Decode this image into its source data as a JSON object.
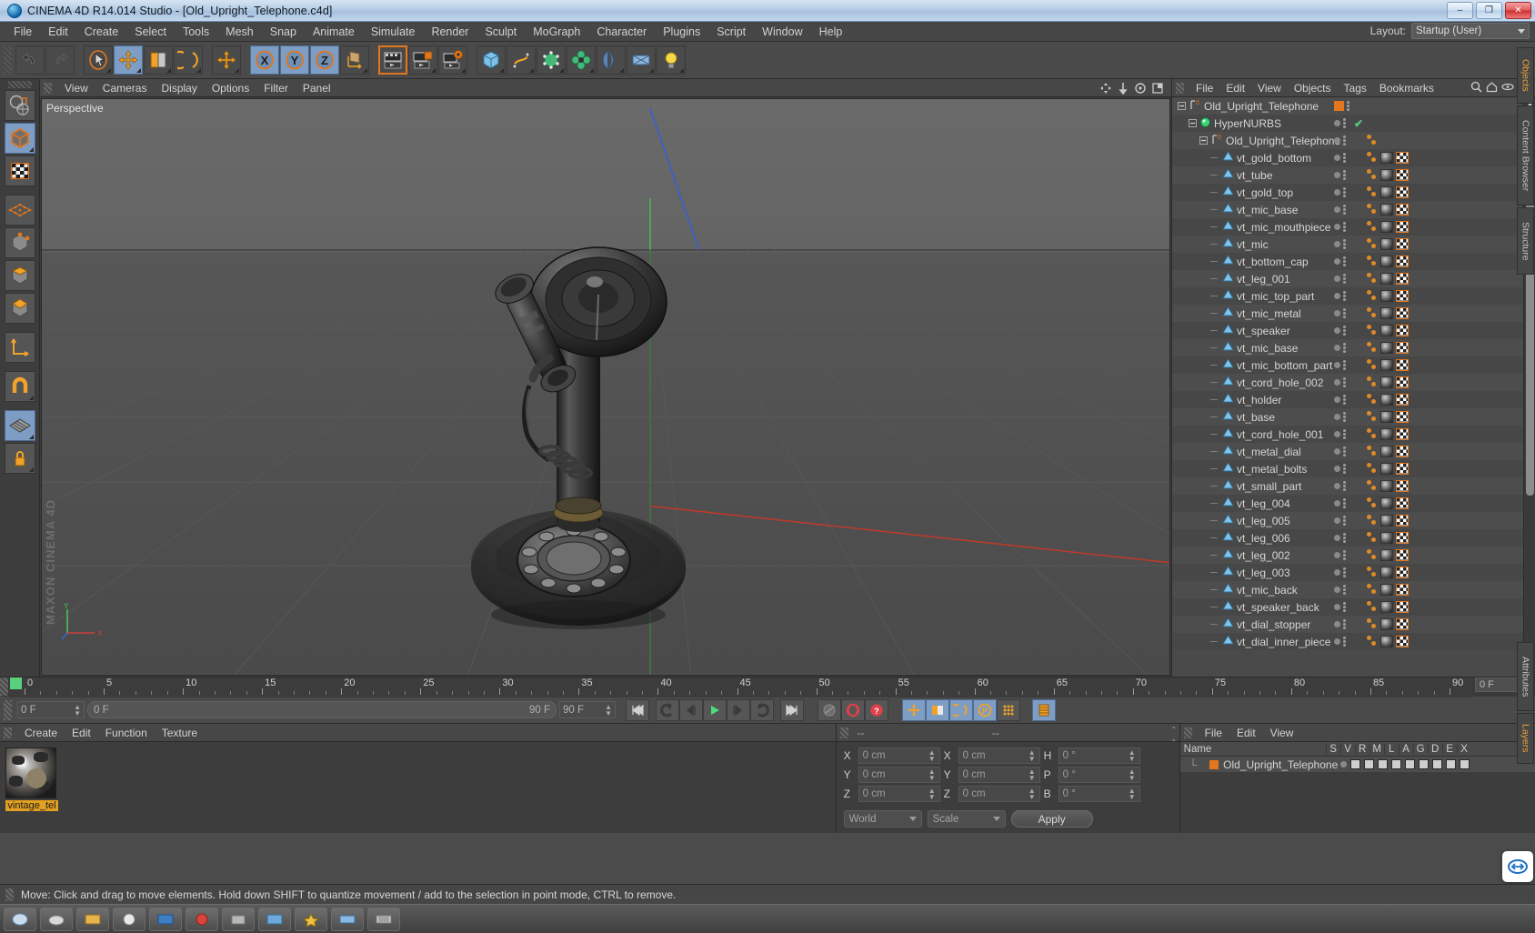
{
  "window": {
    "title": "CINEMA 4D R14.014 Studio - [Old_Upright_Telephone.c4d]",
    "minimize": "–",
    "maximize": "❐",
    "close": "✕"
  },
  "menubar": {
    "items": [
      "File",
      "Edit",
      "Create",
      "Select",
      "Tools",
      "Mesh",
      "Snap",
      "Animate",
      "Simulate",
      "Render",
      "Sculpt",
      "MoGraph",
      "Character",
      "Plugins",
      "Script",
      "Window",
      "Help"
    ],
    "layout_label": "Layout:",
    "layout_value": "Startup (User)"
  },
  "toolbar": {
    "groups": [
      {
        "buttons": [
          {
            "name": "undo-button",
            "icon": "undo-icon",
            "state": "normal"
          },
          {
            "name": "redo-button",
            "icon": "redo-icon",
            "state": "disabled"
          }
        ]
      },
      {
        "buttons": [
          {
            "name": "live-selection-button",
            "icon": "cursor-select-icon",
            "state": "normal"
          },
          {
            "name": "move-tool-button",
            "icon": "move-icon",
            "state": "selected"
          },
          {
            "name": "scale-tool-button",
            "icon": "scale-icon",
            "state": "normal"
          },
          {
            "name": "rotate-tool-button",
            "icon": "rotate-icon",
            "state": "normal"
          }
        ]
      },
      {
        "buttons": [
          {
            "name": "move-duplicate-button",
            "icon": "move-plus-icon",
            "state": "normal"
          }
        ]
      },
      {
        "buttons": [
          {
            "name": "x-axis-lock-button",
            "icon": "axis-x-icon",
            "state": "selected"
          },
          {
            "name": "y-axis-lock-button",
            "icon": "axis-y-icon",
            "state": "selected"
          },
          {
            "name": "z-axis-lock-button",
            "icon": "axis-z-icon",
            "state": "selected"
          },
          {
            "name": "world-object-coordinate-button",
            "icon": "world-axis-icon",
            "state": "normal"
          }
        ]
      },
      {
        "buttons": [
          {
            "name": "render-view-button",
            "icon": "clapper-icon",
            "state": "outlined"
          },
          {
            "name": "render-region-button",
            "icon": "clapper-region-icon",
            "state": "normal"
          },
          {
            "name": "render-settings-button",
            "icon": "clapper-gear-icon",
            "state": "normal"
          }
        ]
      },
      {
        "buttons": [
          {
            "name": "add-cube-button",
            "icon": "cube-icon",
            "state": "normal"
          },
          {
            "name": "add-spline-button",
            "icon": "spline-icon",
            "state": "normal"
          },
          {
            "name": "add-generator-button",
            "icon": "nurbs-icon",
            "state": "normal"
          },
          {
            "name": "add-deformer-button",
            "icon": "deformer-icon",
            "state": "normal"
          },
          {
            "name": "add-environment-button",
            "icon": "environment-icon",
            "state": "normal"
          },
          {
            "name": "add-camera-button",
            "icon": "camera-icon",
            "state": "normal"
          },
          {
            "name": "add-light-button",
            "icon": "light-bulb-icon",
            "state": "normal"
          }
        ]
      }
    ]
  },
  "leftbar": {
    "buttons": [
      {
        "name": "model-mode-button",
        "icon": "cube-model-icon",
        "state": "selected"
      },
      {
        "name": "texture-mode-button",
        "icon": "checker-texture-icon",
        "state": "normal"
      },
      {
        "name": "points-mode-button",
        "icon": "points-grid-icon",
        "state": "normal"
      },
      {
        "name": "edges-mode-button",
        "icon": "edge-cube-icon",
        "state": "normal"
      },
      {
        "name": "polygons-mode-button",
        "icon": "polygon-cube-icon",
        "state": "normal"
      },
      {
        "name": "faces-mode-button",
        "icon": "face-cube-icon",
        "state": "normal"
      },
      {
        "name": "axis-mode-button",
        "icon": "axis-arrow-icon",
        "state": "normal"
      },
      {
        "name": "enable-snap-button",
        "icon": "magnet-icon",
        "state": "normal"
      },
      {
        "name": "workplane-button",
        "icon": "workplane-grid-icon",
        "state": "selected"
      },
      {
        "name": "lock-workplane-button",
        "icon": "lock-icon",
        "state": "normal"
      }
    ]
  },
  "viewport": {
    "menu": [
      "View",
      "Cameras",
      "Display",
      "Options",
      "Filter",
      "Panel"
    ],
    "label": "Perspective",
    "axis_labels": {
      "x": "X",
      "y": "Y",
      "z": "Z"
    },
    "hud_icons": [
      "move-view-icon",
      "pan-view-icon",
      "rotate-view-icon",
      "maximize-view-icon"
    ]
  },
  "object_manager": {
    "menu": [
      "File",
      "Edit",
      "View",
      "Objects",
      "Tags",
      "Bookmarks"
    ],
    "header_icons": [
      "search-icon",
      "home-icon",
      "eye-icon",
      "expand-icon"
    ],
    "tree": [
      {
        "label": "Old_Upright_Telephone",
        "depth": 0,
        "icon": "null-object-icon",
        "type": "null",
        "swatch": "#e2761c",
        "has_tags": false
      },
      {
        "label": "HyperNURBS",
        "depth": 1,
        "icon": "hypernurbs-icon",
        "type": "generator",
        "check": true,
        "has_tags": false
      },
      {
        "label": "Old_Upright_Telephone",
        "depth": 2,
        "icon": "null-object-icon",
        "type": "null",
        "has_tags": false,
        "has_dots": true
      },
      {
        "label": "vt_gold_bottom",
        "depth": 3,
        "icon": "polygon-object-icon",
        "type": "mesh",
        "has_tags": true
      },
      {
        "label": "vt_tube",
        "depth": 3,
        "icon": "polygon-object-icon",
        "type": "mesh",
        "has_tags": true
      },
      {
        "label": "vt_gold_top",
        "depth": 3,
        "icon": "polygon-object-icon",
        "type": "mesh",
        "has_tags": true
      },
      {
        "label": "vt_mic_base",
        "depth": 3,
        "icon": "polygon-object-icon",
        "type": "mesh",
        "has_tags": true
      },
      {
        "label": "vt_mic_mouthpiece",
        "depth": 3,
        "icon": "polygon-object-icon",
        "type": "mesh",
        "has_tags": true
      },
      {
        "label": "vt_mic",
        "depth": 3,
        "icon": "polygon-object-icon",
        "type": "mesh",
        "has_tags": true
      },
      {
        "label": "vt_bottom_cap",
        "depth": 3,
        "icon": "polygon-object-icon",
        "type": "mesh",
        "has_tags": true
      },
      {
        "label": "vt_leg_001",
        "depth": 3,
        "icon": "polygon-object-icon",
        "type": "mesh",
        "has_tags": true
      },
      {
        "label": "vt_mic_top_part",
        "depth": 3,
        "icon": "polygon-object-icon",
        "type": "mesh",
        "has_tags": true
      },
      {
        "label": "vt_mic_metal",
        "depth": 3,
        "icon": "polygon-object-icon",
        "type": "mesh",
        "has_tags": true
      },
      {
        "label": "vt_speaker",
        "depth": 3,
        "icon": "polygon-object-icon",
        "type": "mesh",
        "has_tags": true
      },
      {
        "label": "vt_mic_base",
        "depth": 3,
        "icon": "polygon-object-icon",
        "type": "mesh",
        "has_tags": true
      },
      {
        "label": "vt_mic_bottom_part",
        "depth": 3,
        "icon": "polygon-object-icon",
        "type": "mesh",
        "has_tags": true
      },
      {
        "label": "vt_cord_hole_002",
        "depth": 3,
        "icon": "polygon-object-icon",
        "type": "mesh",
        "has_tags": true
      },
      {
        "label": "vt_holder",
        "depth": 3,
        "icon": "polygon-object-icon",
        "type": "mesh",
        "has_tags": true
      },
      {
        "label": "vt_base",
        "depth": 3,
        "icon": "polygon-object-icon",
        "type": "mesh",
        "has_tags": true
      },
      {
        "label": "vt_cord_hole_001",
        "depth": 3,
        "icon": "polygon-object-icon",
        "type": "mesh",
        "has_tags": true
      },
      {
        "label": "vt_metal_dial",
        "depth": 3,
        "icon": "polygon-object-icon",
        "type": "mesh",
        "has_tags": true
      },
      {
        "label": "vt_metal_bolts",
        "depth": 3,
        "icon": "polygon-object-icon",
        "type": "mesh",
        "has_tags": true
      },
      {
        "label": "vt_small_part",
        "depth": 3,
        "icon": "polygon-object-icon",
        "type": "mesh",
        "has_tags": true
      },
      {
        "label": "vt_leg_004",
        "depth": 3,
        "icon": "polygon-object-icon",
        "type": "mesh",
        "has_tags": true
      },
      {
        "label": "vt_leg_005",
        "depth": 3,
        "icon": "polygon-object-icon",
        "type": "mesh",
        "has_tags": true
      },
      {
        "label": "vt_leg_006",
        "depth": 3,
        "icon": "polygon-object-icon",
        "type": "mesh",
        "has_tags": true
      },
      {
        "label": "vt_leg_002",
        "depth": 3,
        "icon": "polygon-object-icon",
        "type": "mesh",
        "has_tags": true
      },
      {
        "label": "vt_leg_003",
        "depth": 3,
        "icon": "polygon-object-icon",
        "type": "mesh",
        "has_tags": true
      },
      {
        "label": "vt_mic_back",
        "depth": 3,
        "icon": "polygon-object-icon",
        "type": "mesh",
        "has_tags": true
      },
      {
        "label": "vt_speaker_back",
        "depth": 3,
        "icon": "polygon-object-icon",
        "type": "mesh",
        "has_tags": true
      },
      {
        "label": "vt_dial_stopper",
        "depth": 3,
        "icon": "polygon-object-icon",
        "type": "mesh",
        "has_tags": true
      },
      {
        "label": "vt_dial_inner_piece",
        "depth": 3,
        "icon": "polygon-object-icon",
        "type": "mesh",
        "has_tags": true
      }
    ]
  },
  "timeline": {
    "ticks": [
      "0",
      "5",
      "10",
      "15",
      "20",
      "25",
      "30",
      "35",
      "40",
      "45",
      "50",
      "55",
      "60",
      "65",
      "70",
      "75",
      "80",
      "85",
      "90"
    ],
    "current_frame_display": "0 F",
    "playhead_frame": 0
  },
  "transport": {
    "current_frame": "0 F",
    "range_start": "0 F",
    "range_end": "90 F",
    "end_frame_field": "90 F",
    "buttons": [
      {
        "name": "go-to-start-button",
        "icon": "skip-start-icon"
      },
      {
        "name": "play-backwards-loop-button",
        "icon": "loop-back-icon"
      },
      {
        "name": "previous-frame-button",
        "icon": "step-back-icon"
      },
      {
        "name": "play-button",
        "icon": "play-icon"
      },
      {
        "name": "next-frame-button",
        "icon": "step-forward-icon"
      },
      {
        "name": "play-forward-loop-button",
        "icon": "loop-forward-icon"
      },
      {
        "name": "go-to-end-button",
        "icon": "skip-end-icon"
      },
      {
        "name": "record-active-objects-button",
        "icon": "record-icon"
      },
      {
        "name": "autokeying-button",
        "icon": "autokey-icon"
      },
      {
        "name": "keyframe-selection-button",
        "icon": "key-selection-icon"
      },
      {
        "name": "position-key-button",
        "icon": "position-key-icon"
      },
      {
        "name": "scale-key-button",
        "icon": "scale-key-icon"
      },
      {
        "name": "rotation-key-button",
        "icon": "rotation-key-icon"
      },
      {
        "name": "param-key-button",
        "icon": "param-key-icon"
      },
      {
        "name": "point-level-animation-button",
        "icon": "pla-icon"
      },
      {
        "name": "timeline-toggle-button",
        "icon": "timeline-icon"
      }
    ]
  },
  "material_manager": {
    "menu": [
      "Create",
      "Edit",
      "Function",
      "Texture"
    ],
    "materials": [
      {
        "name": "vintage_tel",
        "selected": true
      }
    ]
  },
  "coordinates": {
    "col_headers": [
      "--",
      "--",
      "--"
    ],
    "rows": [
      {
        "label1": "X",
        "value1": "0 cm",
        "label2": "X",
        "value2": "0 cm",
        "label3": "H",
        "value3": "0 °"
      },
      {
        "label1": "Y",
        "value1": "0 cm",
        "label2": "Y",
        "value2": "0 cm",
        "label3": "P",
        "value3": "0 °"
      },
      {
        "label1": "Z",
        "value1": "0 cm",
        "label2": "Z",
        "value2": "0 cm",
        "label3": "B",
        "value3": "0 °"
      }
    ],
    "space_select": "World",
    "mode_select": "Scale",
    "apply_label": "Apply"
  },
  "layers_panel": {
    "menu": [
      "File",
      "Edit",
      "View"
    ],
    "columns": [
      "Name",
      "S",
      "V",
      "R",
      "M",
      "L",
      "A",
      "G",
      "D",
      "E",
      "X"
    ],
    "rows": [
      {
        "name": "Old_Upright_Telephone",
        "swatch": "#e2761c"
      }
    ]
  },
  "right_tabs": {
    "top": [
      {
        "label": "Objects",
        "active": true
      },
      {
        "label": "Content Browser",
        "active": false
      },
      {
        "label": "Structure",
        "active": false
      }
    ],
    "bottom": [
      {
        "label": "Attributes",
        "active": false
      },
      {
        "label": "Layers",
        "active": true
      }
    ]
  },
  "status": {
    "message": "Move: Click and drag to move elements. Hold down SHIFT to quantize movement / add to the selection in point mode, CTRL to remove."
  },
  "branding": {
    "line1": "MAXON",
    "line2": "CINEMA 4D"
  }
}
